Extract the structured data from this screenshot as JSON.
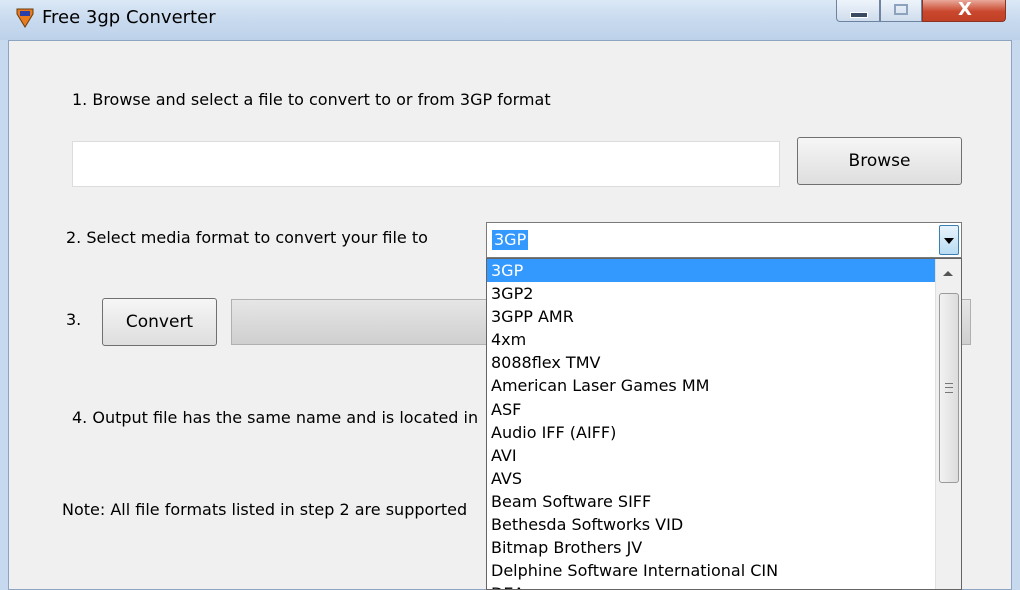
{
  "window": {
    "title": "Free 3gp Converter",
    "controls": {
      "minimize_icon": "minimize-icon",
      "maximize_icon": "maximize-icon",
      "close_label": "X"
    }
  },
  "step1": {
    "label": "1. Browse and select a file to convert to or from 3GP format",
    "input_value": "",
    "browse_label": "Browse"
  },
  "step2": {
    "label": "2. Select media format to convert your file to",
    "selected": "3GP",
    "options": [
      "3GP",
      "3GP2",
      "3GPP AMR",
      "4xm",
      "8088flex TMV",
      "American Laser Games MM",
      "ASF",
      "Audio IFF (AIFF)",
      "AVI",
      "AVS",
      "Beam Software SIFF",
      "Bethesda Softworks VID",
      "Bitmap Brothers JV",
      "Delphine Software International CIN",
      "DEA"
    ]
  },
  "step3": {
    "label": "3.",
    "convert_label": "Convert",
    "progress": 0
  },
  "step4": {
    "label": "4. Output file has the same name and is located in"
  },
  "note": {
    "text": "Note: All file formats listed in step 2 are supported"
  },
  "colors": {
    "accent": "#3399ff",
    "client_bg": "#f0f0f0",
    "titlebar": "#c7d9ee",
    "close_button": "#c9472d"
  }
}
